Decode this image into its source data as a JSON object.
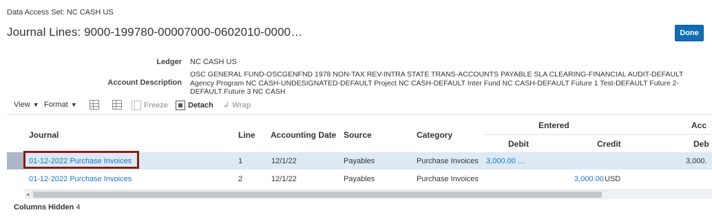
{
  "header": {
    "data_access_label": "Data Access Set:",
    "data_access_value": "NC CASH US",
    "title": "Journal Lines: 9000-199780-00007000-0602010-0000…",
    "done_label": "Done"
  },
  "details": {
    "ledger_label": "Ledger",
    "ledger_value": "NC CASH US",
    "account_label": "Account Description",
    "account_value": "OSC GENERAL FUND-OSCGENFND 1978 NON-TAX REV-INTRA STATE TRANS-ACCOUNTS PAYABLE SLA CLEARING-FINANCIAL AUDIT-DEFAULT Agency Program NC CASH-UNDESIGNATED-DEFAULT Project NC CASH-DEFAULT Inter Fund NC CASH-DEFAULT Future 1 Test-DEFAULT Future 2-DEFAULT Future 3 NC CASH"
  },
  "toolbar": {
    "view_label": "View",
    "format_label": "Format",
    "freeze_label": "Freeze",
    "detach_label": "Detach",
    "wrap_label": "Wrap"
  },
  "table": {
    "headers": {
      "journal": "Journal",
      "line": "Line",
      "accounting_date": "Accounting Date",
      "source": "Source",
      "category": "Category",
      "entered_group": "Entered",
      "debit": "Debit",
      "credit": "Credit",
      "accounted_group_truncated": "Acc",
      "accounted_debit_truncated": "Deb"
    },
    "rows": [
      {
        "journal": "01-12-2022 Purchase Invoices",
        "line": "1",
        "accounting_date": "12/1/22",
        "source": "Payables",
        "category": "Purchase Invoices",
        "entered_debit": "3,000.00 …",
        "entered_credit": "",
        "currency": "",
        "accounted_debit": "3,000."
      },
      {
        "journal": "01-12-2022 Purchase Invoices",
        "line": "2",
        "accounting_date": "12/1/22",
        "source": "Payables",
        "category": "Purchase Invoices",
        "entered_debit": "",
        "entered_credit": "3,000.00",
        "currency": "USD",
        "accounted_debit": ""
      }
    ]
  },
  "footer": {
    "columns_hidden_label": "Columns Hidden",
    "columns_hidden_count": "4"
  },
  "colors": {
    "primary_button": "#0f6eb3",
    "link": "#1a73c1",
    "selected_row": "#dde9f5",
    "highlight_box": "#8b1a11"
  }
}
